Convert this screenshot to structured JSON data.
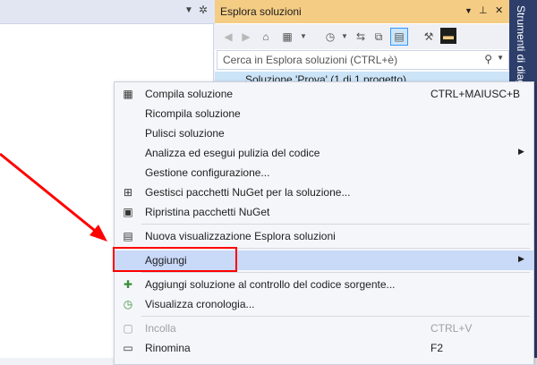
{
  "solution_explorer": {
    "title": "Esplora soluzioni",
    "search_placeholder": "Cerca in Esplora soluzioni (CTRL+è)",
    "tree_item": "Soluzione 'Prova' (1 di 1 progetto)"
  },
  "right_strip": {
    "label": "Strumenti di diagnostica"
  },
  "menu": {
    "items": [
      {
        "label": "Compila soluzione",
        "shortcut": "CTRL+MAIUSC+B",
        "icon": "build-icon"
      },
      {
        "label": "Ricompila soluzione"
      },
      {
        "label": "Pulisci soluzione"
      },
      {
        "label": "Analizza ed esegui pulizia del codice",
        "submenu": true
      },
      {
        "label": "Gestione configurazione..."
      },
      {
        "label": "Gestisci pacchetti NuGet per la soluzione...",
        "icon": "nuget-icon"
      },
      {
        "label": "Ripristina pacchetti NuGet",
        "icon": "restore-icon"
      },
      {
        "label": "Nuova visualizzazione Esplora soluzioni",
        "icon": "new-view-icon"
      },
      {
        "label": "Aggiungi",
        "submenu": true
      },
      {
        "label": "Aggiungi soluzione al controllo del codice sorgente...",
        "icon": "source-control-icon"
      },
      {
        "label": "Visualizza cronologia...",
        "icon": "history-icon"
      },
      {
        "label": "Incolla",
        "shortcut": "CTRL+V",
        "icon": "paste-icon",
        "disabled": true
      },
      {
        "label": "Rinomina",
        "shortcut": "F2",
        "icon": "rename-icon"
      }
    ]
  }
}
